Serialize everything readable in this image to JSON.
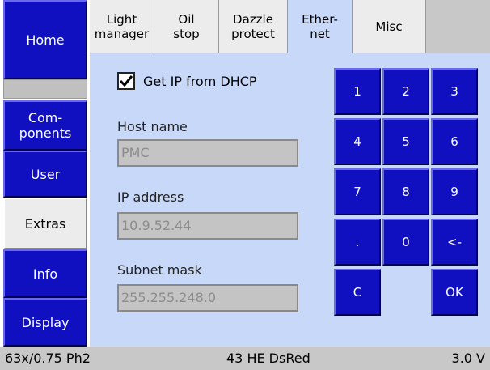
{
  "sidebar": {
    "items": [
      {
        "label": "Home",
        "active": false
      },
      {
        "label": "Com-\nponents",
        "active": false
      },
      {
        "label": "User",
        "active": false
      },
      {
        "label": "Extras",
        "active": true
      },
      {
        "label": "Info",
        "active": false
      },
      {
        "label": "Display",
        "active": false
      }
    ]
  },
  "tabs": [
    {
      "label": "Light\nmanager",
      "active": false
    },
    {
      "label": "Oil\nstop",
      "active": false
    },
    {
      "label": "Dazzle\nprotect",
      "active": false
    },
    {
      "label": "Ether-\nnet",
      "active": true
    },
    {
      "label": "Misc",
      "active": false
    }
  ],
  "ethernet": {
    "dhcp_label": "Get IP from DHCP",
    "dhcp_checked": true,
    "host_name_label": "Host name",
    "host_name_value": "PMC",
    "ip_address_label": "IP address",
    "ip_address_value": "10.9.52.44",
    "subnet_mask_label": "Subnet mask",
    "subnet_mask_value": "255.255.248.0"
  },
  "keypad": {
    "keys": [
      "1",
      "2",
      "3",
      "4",
      "5",
      "6",
      "7",
      "8",
      "9",
      ".",
      "0",
      "<-",
      "C",
      "OK"
    ]
  },
  "statusbar": {
    "left": "63x/0.75 Ph2",
    "middle": "43 HE DsRed",
    "right": "3.0 V"
  },
  "colors": {
    "button_blue": "#1010c0",
    "panel_bg": "#c8d8f8",
    "field_bg": "#c4c4c4"
  }
}
